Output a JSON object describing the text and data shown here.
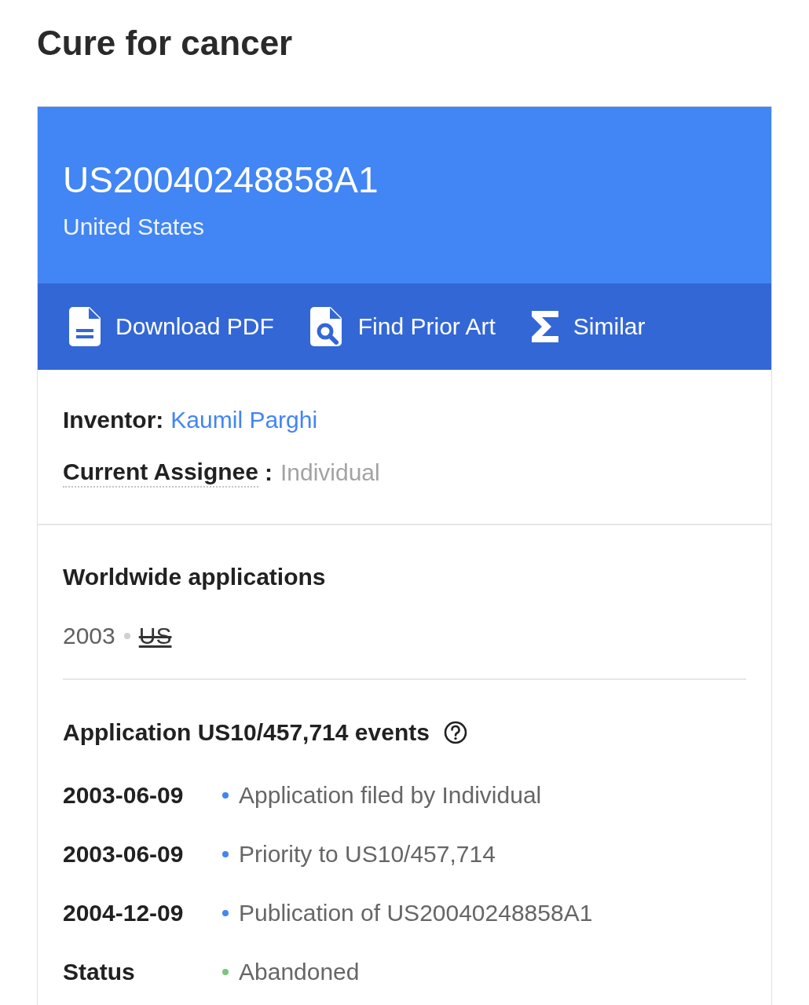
{
  "page_title": "Cure for cancer",
  "header": {
    "publication_number": "US20040248858A1",
    "country": "United States"
  },
  "actions": [
    {
      "kind": "pdf",
      "label": "Download PDF"
    },
    {
      "kind": "prior_art",
      "label": "Find Prior Art"
    },
    {
      "kind": "similar",
      "label": "Similar"
    }
  ],
  "people": {
    "inventor_label": "Inventor:",
    "inventor": "Kaumil Parghi",
    "assignee_label": "Current Assignee",
    "assignee_separator": ":",
    "assignee": "Individual"
  },
  "worldwide": {
    "title": "Worldwide applications",
    "items": [
      {
        "year": "2003",
        "country": "US",
        "struck": true
      }
    ]
  },
  "events": {
    "title": "Application US10/457,714 events",
    "rows": [
      {
        "label": "2003-06-09",
        "text": "Application filed by Individual",
        "color": "#4285f4"
      },
      {
        "label": "2003-06-09",
        "text": "Priority to US10/457,714",
        "color": "#4285f4"
      },
      {
        "label": "2004-12-09",
        "text": "Publication of US20040248858A1",
        "color": "#4285f4"
      },
      {
        "label": "Status",
        "text": "Abandoned",
        "color": "#7cc47f"
      }
    ]
  }
}
